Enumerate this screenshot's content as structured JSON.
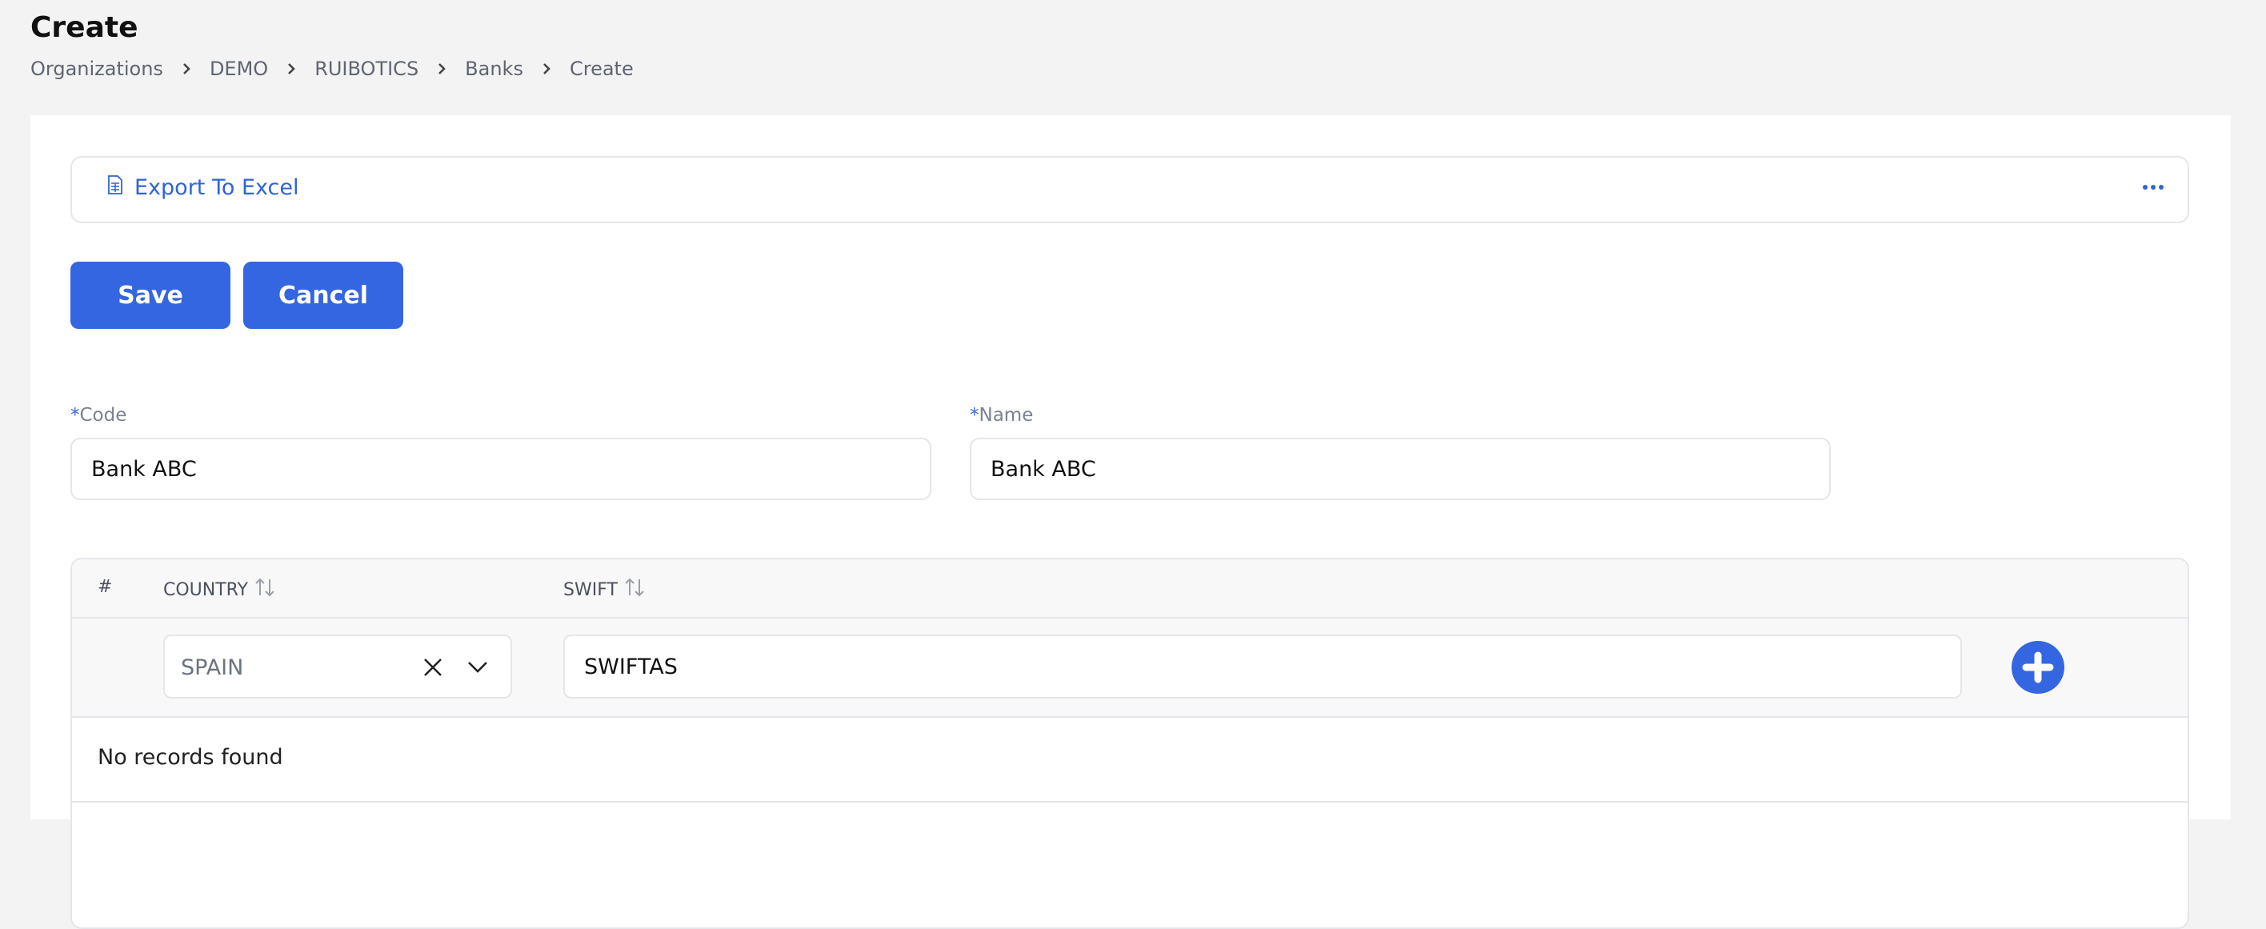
{
  "page": {
    "title": "Create",
    "breadcrumb": [
      "Organizations",
      "DEMO",
      "RUIBOTICS",
      "Banks",
      "Create"
    ]
  },
  "toolbar": {
    "export_label": "Export To Excel",
    "export_icon": "spreadsheet-icon",
    "more_icon": "ellipsis-icon"
  },
  "actions": {
    "save_label": "Save",
    "cancel_label": "Cancel"
  },
  "form": {
    "code": {
      "required_mark": "*",
      "label": "Code",
      "value": "Bank ABC"
    },
    "name": {
      "required_mark": "*",
      "label": "Name",
      "value": "Bank ABC"
    }
  },
  "table": {
    "columns": [
      "#",
      "COUNTRY",
      "SWIFT"
    ],
    "new_row": {
      "country": "SPAIN",
      "swift": "SWIFTAS"
    },
    "empty_message": "No records found"
  },
  "colors": {
    "accent": "#3566e1",
    "background": "#f3f3f3",
    "border": "#e4e6ea"
  }
}
